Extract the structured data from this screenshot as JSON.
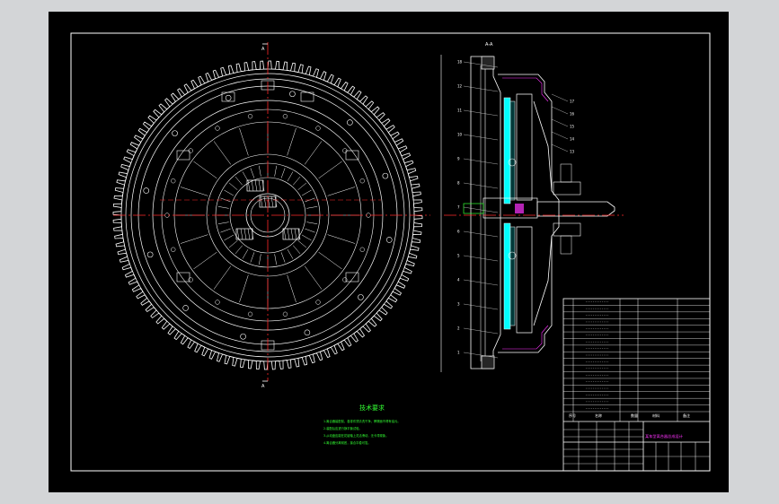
{
  "colors": {
    "background": "#000000",
    "frame": "#ffffff",
    "outline": "#ffffff",
    "centerline": "#ff2a2a",
    "annotation": "#33ff33",
    "section": "#00ffff",
    "accent": "#ff33ff",
    "leader": "#d9d9d9",
    "chrome": "#d3d5d7"
  },
  "front_view": {
    "section_mark_top": "A",
    "section_mark_bottom": "A",
    "teeth": 120
  },
  "side_view": {
    "section_label": "A-A",
    "balloons_right": [
      "17",
      "16",
      "15",
      "14",
      "13"
    ],
    "balloons_left": [
      "18",
      "12",
      "11",
      "10",
      "9",
      "8",
      "7",
      "6",
      "5",
      "4",
      "3",
      "2",
      "1"
    ]
  },
  "notes": {
    "title": "技术要求",
    "lines": [
      "1.离合器装配前，各零件须清洗干净，摩擦面不得有油污。",
      "2.装配后应进行静平衡试验。",
      "3.从动盘应能在花键轴上灵活滑动，无卡滞现象。",
      "4.离合器分离彻底，接合平稳可靠。"
    ]
  },
  "title_block": {
    "drawing_title": "某车型离合器总成设计",
    "header": [
      "序号",
      "名称",
      "数量",
      "材料",
      "备注"
    ],
    "rows": 17
  },
  "icons": [
    "section-arrow-icon"
  ]
}
